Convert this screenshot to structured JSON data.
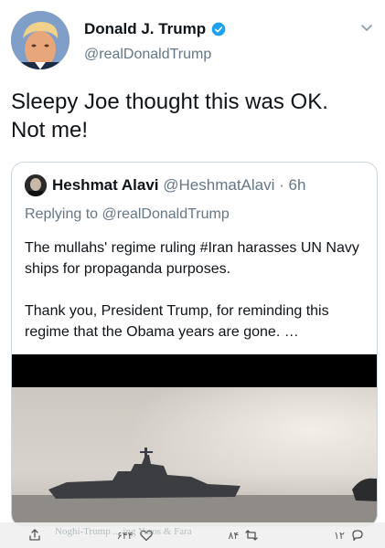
{
  "tweet": {
    "author": {
      "name": "Donald J. Trump",
      "handle": "@realDonaldTrump",
      "verified": true
    },
    "text_line1": "Sleepy Joe thought this was OK.",
    "text_line2": "Not me!"
  },
  "quote": {
    "author": {
      "name": "Heshmat Alavi",
      "handle": "@HeshmatAlavi",
      "time": "6h"
    },
    "replying_to": "Replying to @realDonaldTrump",
    "paragraph1": "The mullahs' regime ruling #Iran harasses UN Navy ships for propaganda purposes.",
    "paragraph2": "Thank you, President Trump, for reminding this regime that the Obama years are gone. …"
  },
  "actions": {
    "share_label": "",
    "like_count": "۶۴۴",
    "retweet_count": "۸۴",
    "reply_count": "۱۲"
  },
  "watermark": "Noghi-Trump ... ing Yaros & Fara",
  "colors": {
    "verified": "#1da1f2",
    "secondary_text": "#657786",
    "border": "#ccd6dd"
  }
}
